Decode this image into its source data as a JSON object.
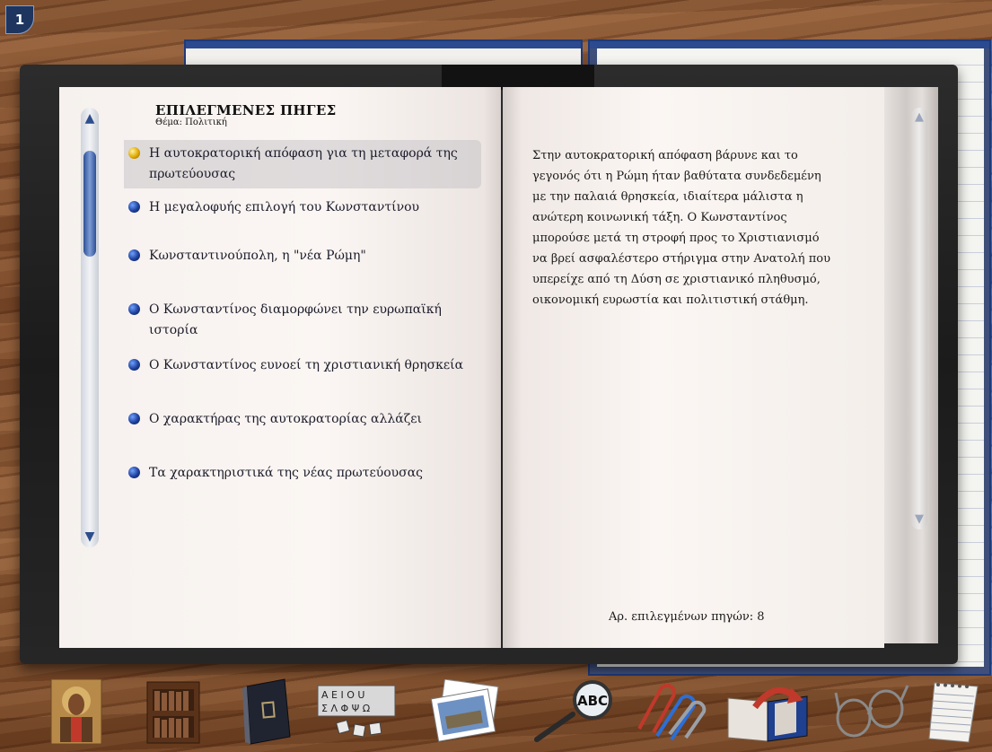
{
  "page_number": "1",
  "heading": {
    "title": "ΕΠΙΛΕΓΜΕΝΕΣ ΠΗΓΕΣ",
    "subtitle": "Θέμα: Πολιτική"
  },
  "sources": [
    {
      "label": "Η αυτοκρατορική απόφαση για τη μεταφορά της πρωτεύουσας",
      "selected": true
    },
    {
      "label": "Η μεγαλοφυής επιλογή του Κωνσταντίνου",
      "selected": false
    },
    {
      "label": "Κωνσταντινούπολη, η \"νέα Ρώμη\"",
      "selected": false
    },
    {
      "label": "Ο Κωνσταντίνος διαμορφώνει την ευρωπαϊκή ιστορία",
      "selected": false
    },
    {
      "label": "Ο Κωνσταντίνος ευνοεί τη χριστιανική θρησκεία",
      "selected": false
    },
    {
      "label": "Ο χαρακτήρας της αυτοκρατορίας αλλάζει",
      "selected": false
    },
    {
      "label": "Τα χαρακτηριστικά της νέας πρωτεύουσας",
      "selected": false
    }
  ],
  "detail_text": "Στην αυτοκρατορική απόφαση βάρυνε και το γεγονός ότι η Ρώμη ήταν βαθύτατα συνδεδεμένη με την παλαιά θρησκεία, ιδιαίτερα μάλιστα η ανώτερη κοινωνική τάξη.  Ο Κωνσταντίνος μπορούσε μετά τη στροφή προς το Χριστιανισμό να βρεί ασφαλέστερο στήριγμα στην Ανατολή που υπερείχε από τη Δύση σε χριστιανικό πληθυσμό, οικονομική ευρωστία και πολιτιστική στάθμη.",
  "count_label": "Αρ. επιλεγμένων πηγών: 8",
  "scroll_arrows": {
    "up": "▲",
    "down": "▼"
  },
  "toolbar_icons": [
    "icon-mosaic-icon",
    "library-books-icon",
    "closed-book-icon",
    "letter-blocks-icon",
    "photographs-icon",
    "magnifier-abc-icon",
    "paperclips-icon",
    "open-book-arrow-icon",
    "eyeglasses-icon",
    "notepad-icon"
  ],
  "magnifier_text": "ABC"
}
